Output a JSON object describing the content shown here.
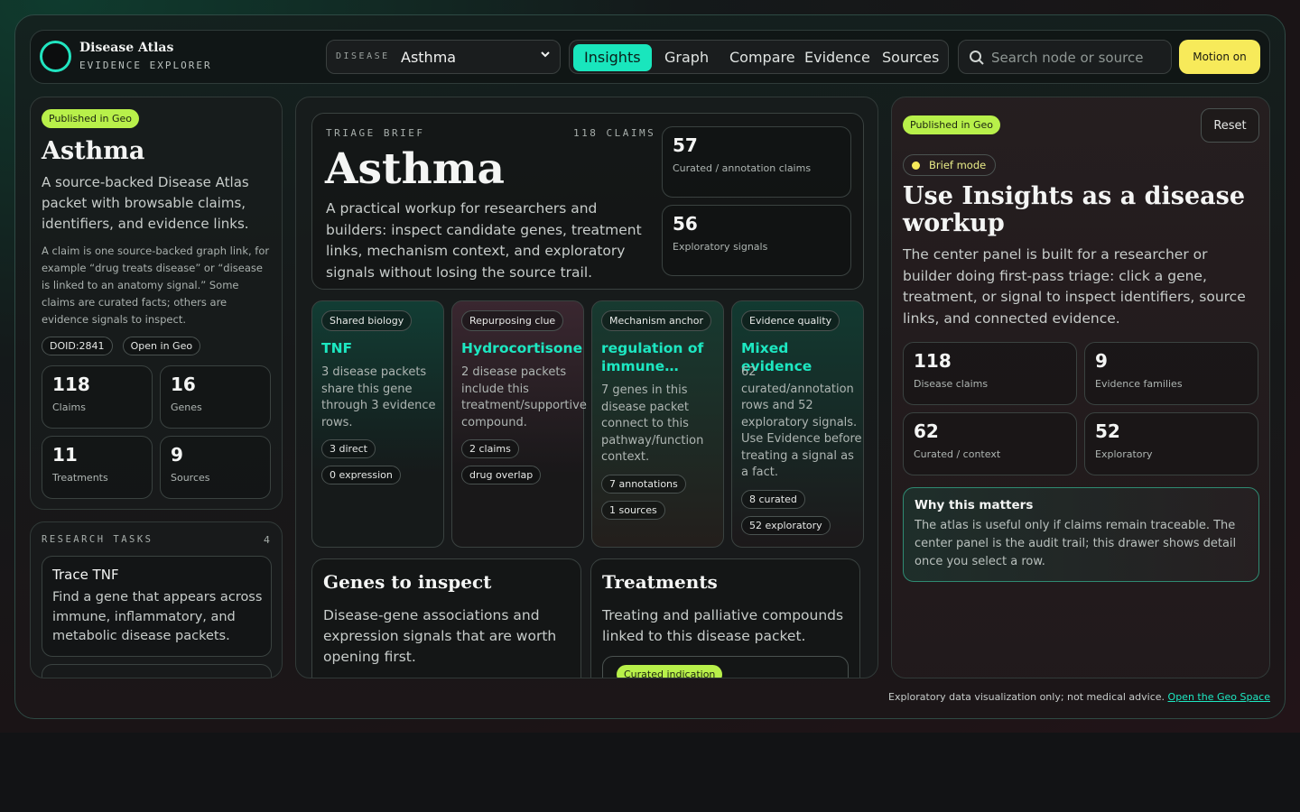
{
  "brand": {
    "title": "Disease Atlas",
    "subtitle": "EVIDENCE EXPLORER"
  },
  "disease_select": {
    "label": "DISEASE",
    "value": "Asthma"
  },
  "tabs": [
    {
      "label": "Insights",
      "active": true
    },
    {
      "label": "Graph",
      "active": false
    },
    {
      "label": "Compare",
      "active": false
    },
    {
      "label": "Evidence",
      "active": false
    },
    {
      "label": "Sources",
      "active": false
    }
  ],
  "search": {
    "placeholder": "Search node or source"
  },
  "motion_button": "Motion on",
  "left": {
    "badge": "Published in Geo",
    "title": "Asthma",
    "description": "A source-backed Disease Atlas packet with browsable claims, identifiers, and evidence links.",
    "note": "A claim is one source-backed graph link, for example “drug treats disease” or “disease is linked to an anatomy signal.” Some claims are curated facts; others are evidence signals to inspect.",
    "chips": [
      "DOID:2841",
      "Open in Geo"
    ],
    "stats": [
      {
        "value": "118",
        "label": "Claims"
      },
      {
        "value": "16",
        "label": "Genes"
      },
      {
        "value": "11",
        "label": "Treatments"
      },
      {
        "value": "9",
        "label": "Sources"
      }
    ]
  },
  "tasks": {
    "heading": "RESEARCH TASKS",
    "count": "4",
    "items": [
      {
        "title": "Trace TNF",
        "description": "Find a gene that appears across immune, inflammatory, and metabolic disease packets."
      }
    ]
  },
  "brief": {
    "heading": "TRIAGE BRIEF",
    "claims": "118 CLAIMS",
    "title": "Asthma",
    "description": "A practical workup for researchers and builders: inspect candidate genes, treatment links, mechanism context, and exploratory signals without losing the source trail.",
    "stats": [
      {
        "value": "57",
        "label": "Curated / annotation claims"
      },
      {
        "value": "56",
        "label": "Exploratory signals"
      }
    ]
  },
  "cards": [
    {
      "tag": "Shared biology",
      "name": "TNF",
      "body": "3 disease packets share this gene through 3 evidence rows.",
      "chips": [
        "3 direct",
        "0 expression"
      ],
      "tint": "#123d34"
    },
    {
      "tag": "Repurposing clue",
      "name": "Hydrocortisone",
      "body": "2 disease packets include this treatment/supportive compound.",
      "chips": [
        "2 claims",
        "drug overlap"
      ],
      "tint": "#3a2730"
    },
    {
      "tag": "Mechanism anchor",
      "name": "regulation of immune…",
      "body": "7 genes in this disease packet connect to this pathway/function context.",
      "chips": [
        "7 annotations",
        "1 sources"
      ],
      "tint": "#173a30"
    },
    {
      "tag": "Evidence quality",
      "name": "Mixed evidence",
      "body": "62 curated/annotation rows and 52 exploratory signals. Use Evidence before treating a signal as a fact.",
      "chips": [
        "8 curated",
        "52 exploratory"
      ],
      "tint": "#123a31"
    }
  ],
  "genes": {
    "title": "Genes to inspect",
    "description": "Disease-gene associations and expression signals that are worth opening first."
  },
  "treatments": {
    "title": "Treatments",
    "description": "Treating and palliative compounds linked to this disease packet.",
    "first_badge": "Curated indication"
  },
  "right": {
    "badge": "Published in Geo",
    "reset": "Reset",
    "mode": "Brief mode",
    "title": "Use Insights as a disease workup",
    "description": "The center panel is built for a researcher or builder doing first-pass triage: click a gene, treatment, or signal to inspect identifiers, source links, and connected evidence.",
    "stats": [
      {
        "value": "118",
        "label": "Disease claims"
      },
      {
        "value": "9",
        "label": "Evidence families"
      },
      {
        "value": "62",
        "label": "Curated / context"
      },
      {
        "value": "52",
        "label": "Exploratory"
      }
    ],
    "why_title": "Why this matters",
    "why_text": "The atlas is useful only if claims remain traceable. The center panel is the audit trail; this drawer shows detail once you select a row."
  },
  "footer": {
    "text": "Exploratory data visualization only; not medical advice.",
    "link": "Open the Geo Space"
  },
  "colors": {
    "accent": "#19e6bd",
    "highlight": "#b8f04a",
    "yellow": "#f7ea5a"
  }
}
